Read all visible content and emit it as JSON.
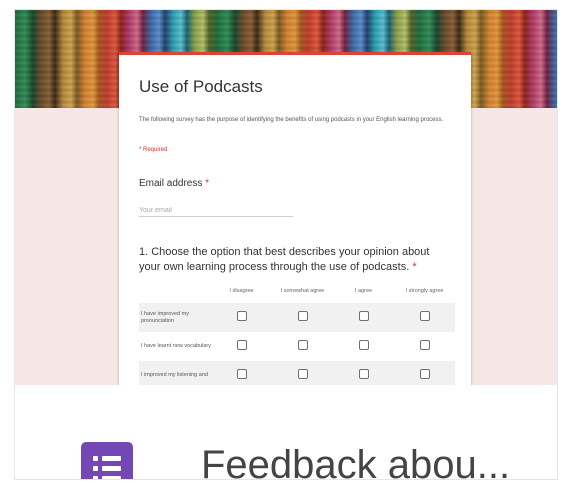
{
  "form": {
    "title": "Use of Podcasts",
    "description": "The following survey has the purpose of identifying the benefits of using podcasts in your English learning process.",
    "required_note": "* Required",
    "email": {
      "label": "Email address",
      "required_mark": "*",
      "placeholder": "Your email"
    },
    "question": {
      "text": "1. Choose the option that best describes your opinion about your own learning process through the use of podcasts.",
      "required_mark": "*",
      "columns": [
        "I disagree",
        "I somewhat agree",
        "I agree",
        "I strongly agree"
      ],
      "rows": [
        {
          "label": "I have improved my pronunciation"
        },
        {
          "label": "I have learnt new vocabulary"
        },
        {
          "label": "I improved my listening and"
        }
      ]
    }
  },
  "footer": {
    "icon": "google-forms-icon",
    "title": "Feedback abou..."
  },
  "colors": {
    "accent": "#db4437",
    "forms_purple": "#7348b4",
    "background_tint": "#f6e6e6"
  }
}
